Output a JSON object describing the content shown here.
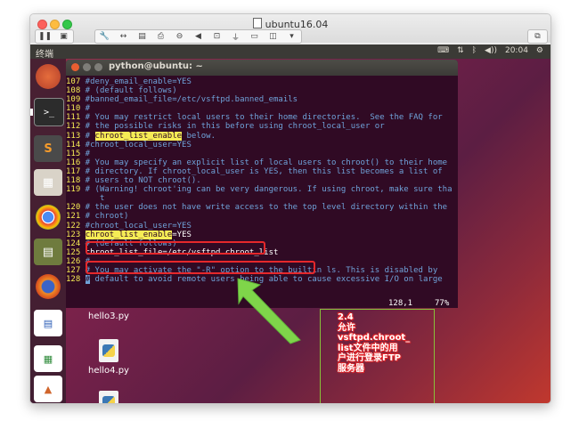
{
  "window": {
    "title": "ubuntu16.04",
    "toolbar_icons": [
      "pause-icon",
      "snapshot-icon",
      "wrench-icon",
      "resize-arrows-icon",
      "hdd-icon",
      "printer-icon",
      "disk-icon",
      "speaker-icon",
      "network-icon",
      "usb-icon",
      "folder-icon",
      "screenshot-icon",
      "expand-icon"
    ]
  },
  "topbar": {
    "app_name": "终端",
    "time": "20:04"
  },
  "terminal": {
    "title": "python@ubuntu: ~",
    "lines": [
      {
        "num": "107",
        "text": " #deny_email_enable=YES"
      },
      {
        "num": "108",
        "text": " # (default follows)"
      },
      {
        "num": "109",
        "text": " #banned_email_file=/etc/vsftpd.banned_emails"
      },
      {
        "num": "110",
        "text": " #"
      },
      {
        "num": "111",
        "text": " # You may restrict local users to their home directories.  See the FAQ for"
      },
      {
        "num": "112",
        "text": " # the possible risks in this before using chroot_local_user or"
      },
      {
        "num": "113",
        "text": " # ",
        "hl": "chroot_list_enable",
        "rest": " below."
      },
      {
        "num": "114",
        "text": " #chroot_local_user=YES"
      },
      {
        "num": "115",
        "text": " #"
      },
      {
        "num": "116",
        "text": " # You may specify an explicit list of local users to chroot() to their home"
      },
      {
        "num": "117",
        "text": " # directory. If chroot_local_user is YES, then this list becomes a list of"
      },
      {
        "num": "118",
        "text": " # users to NOT chroot()."
      },
      {
        "num": "119",
        "text": " # (Warning! chroot'ing can be very dangerous. If using chroot, make sure tha"
      },
      {
        "num": "",
        "text": "    t"
      },
      {
        "num": "120",
        "text": " # the user does not have write access to the top level directory within the"
      },
      {
        "num": "121",
        "text": " # chroot)"
      },
      {
        "num": "122",
        "text": " #chroot_local_user=YES"
      },
      {
        "num": "123",
        "text": " ",
        "hl": "chroot_list_enable",
        "rest": "=YES",
        "white": true
      },
      {
        "num": "124",
        "text": " # (default follows)"
      },
      {
        "num": "125",
        "text": " chroot_list_file=/etc/vsftpd.chroot_list",
        "white": true
      },
      {
        "num": "126",
        "text": " #"
      },
      {
        "num": "127",
        "text": " # You may activate the \"-R\" option to the builtin ls. This is disabled by"
      },
      {
        "num": "128",
        "text": " ",
        "cursor": "#",
        "rest": " default to avoid remote users being able to cause excessive I/O on large"
      }
    ],
    "status_pos": "128,1",
    "status_pct": "77%"
  },
  "desktop": {
    "files": [
      {
        "name": "hello3.py"
      },
      {
        "name": "hello4.py"
      },
      {
        "name": ""
      }
    ]
  },
  "annotation": {
    "text": "2.4\n允许\nvsftpd.chroot_\nlist文件中的用\n户进行登录FTP\n服务器"
  },
  "colors": {
    "terminal_bg": "#300a24",
    "line_number": "#f6ec55",
    "highlight": "#f6ec55",
    "annotation_red": "#e6282b",
    "arrow_green": "#7fd54a"
  }
}
